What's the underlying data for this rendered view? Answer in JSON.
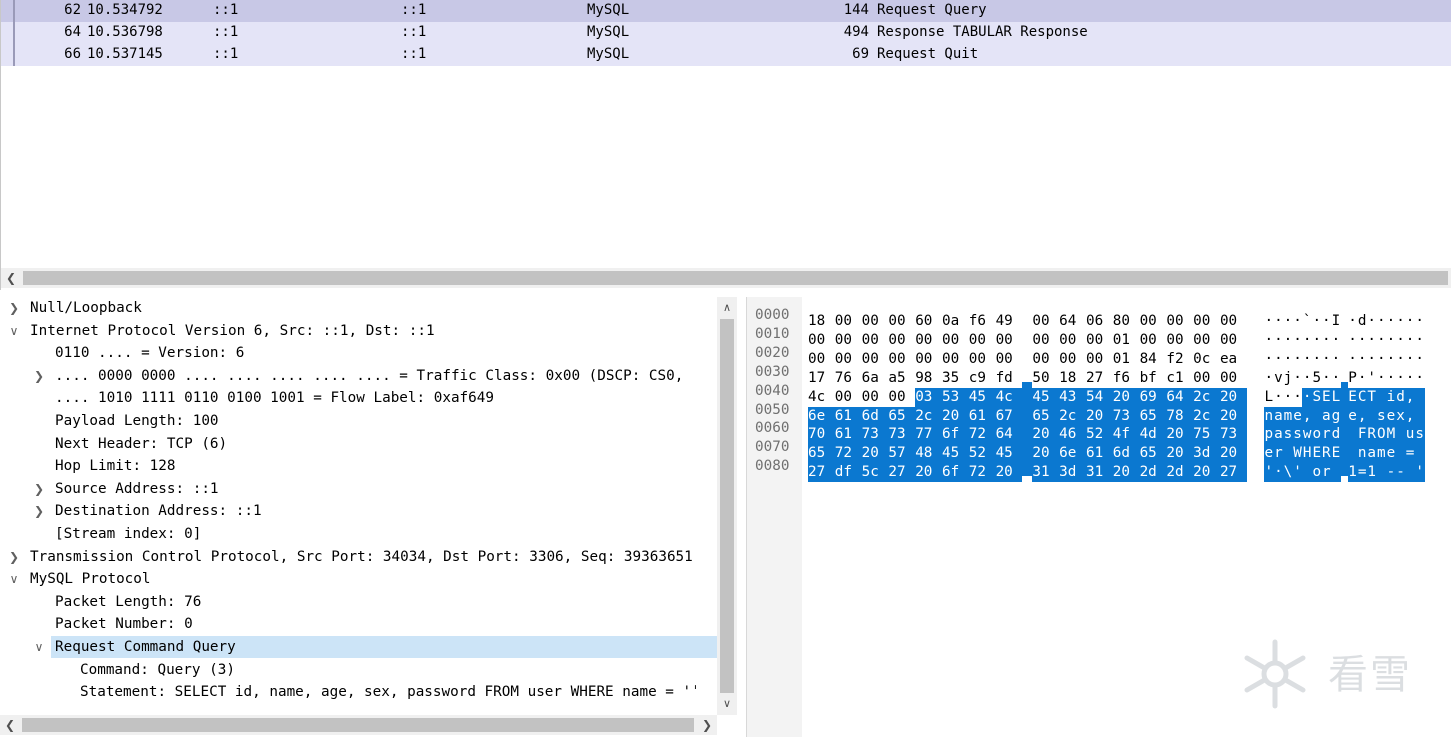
{
  "packet_list": {
    "rows": [
      {
        "no": "62",
        "time": "10.534792",
        "src": "::1",
        "dst": "::1",
        "proto": "MySQL",
        "len": "144",
        "info": "Request Query",
        "state": "selected"
      },
      {
        "no": "64",
        "time": "10.536798",
        "src": "::1",
        "dst": "::1",
        "proto": "MySQL",
        "len": "494",
        "info": "Response TABULAR Response",
        "state": "normal"
      },
      {
        "no": "66",
        "time": "10.537145",
        "src": "::1",
        "dst": "::1",
        "proto": "MySQL",
        "len": "69",
        "info": "Request Quit",
        "state": "normal"
      }
    ]
  },
  "details": {
    "rows": [
      {
        "indent": 0,
        "twisty": "collapsed",
        "text": "Null/Loopback"
      },
      {
        "indent": 0,
        "twisty": "expanded",
        "text": "Internet Protocol Version 6, Src: ::1, Dst: ::1"
      },
      {
        "indent": 1,
        "twisty": "none",
        "text": "0110 .... = Version: 6"
      },
      {
        "indent": 1,
        "twisty": "collapsed",
        "text": ".... 0000 0000 .... .... .... .... .... = Traffic Class: 0x00 (DSCP: CS0,"
      },
      {
        "indent": 1,
        "twisty": "none",
        "text": ".... 1010 1111 0110 0100 1001 = Flow Label: 0xaf649"
      },
      {
        "indent": 1,
        "twisty": "none",
        "text": "Payload Length: 100"
      },
      {
        "indent": 1,
        "twisty": "none",
        "text": "Next Header: TCP (6)"
      },
      {
        "indent": 1,
        "twisty": "none",
        "text": "Hop Limit: 128"
      },
      {
        "indent": 1,
        "twisty": "collapsed",
        "text": "Source Address: ::1"
      },
      {
        "indent": 1,
        "twisty": "collapsed",
        "text": "Destination Address: ::1"
      },
      {
        "indent": 1,
        "twisty": "none",
        "text": "[Stream index: 0]"
      },
      {
        "indent": 0,
        "twisty": "collapsed",
        "text": "Transmission Control Protocol, Src Port: 34034, Dst Port: 3306, Seq: 39363651"
      },
      {
        "indent": 0,
        "twisty": "expanded",
        "text": "MySQL Protocol"
      },
      {
        "indent": 1,
        "twisty": "none",
        "text": "Packet Length: 76"
      },
      {
        "indent": 1,
        "twisty": "none",
        "text": "Packet Number: 0"
      },
      {
        "indent": 1,
        "twisty": "expanded",
        "text": "Request Command Query",
        "highlight": true
      },
      {
        "indent": 2,
        "twisty": "none",
        "text": "Command: Query (3)"
      },
      {
        "indent": 2,
        "twisty": "none",
        "text": "Statement: SELECT id, name, age, sex, password FROM user WHERE name = 'ˈ"
      }
    ]
  },
  "bytes": {
    "rows": [
      {
        "offset": "0000",
        "hex": [
          "18",
          "00",
          "00",
          "00",
          "60",
          "0a",
          "f6",
          "49",
          "00",
          "64",
          "06",
          "80",
          "00",
          "00",
          "00",
          "00"
        ],
        "ascii": [
          "·",
          "·",
          "·",
          "·",
          "`",
          "·",
          "·",
          "I",
          "·",
          "d",
          "·",
          "·",
          "·",
          "·",
          "·",
          "·"
        ],
        "sel_from": 16
      },
      {
        "offset": "0010",
        "hex": [
          "00",
          "00",
          "00",
          "00",
          "00",
          "00",
          "00",
          "00",
          "00",
          "00",
          "00",
          "01",
          "00",
          "00",
          "00",
          "00"
        ],
        "ascii": [
          "·",
          "·",
          "·",
          "·",
          "·",
          "·",
          "·",
          "·",
          "·",
          "·",
          "·",
          "·",
          "·",
          "·",
          "·",
          "·"
        ],
        "sel_from": 16
      },
      {
        "offset": "0020",
        "hex": [
          "00",
          "00",
          "00",
          "00",
          "00",
          "00",
          "00",
          "00",
          "00",
          "00",
          "00",
          "01",
          "84",
          "f2",
          "0c",
          "ea"
        ],
        "ascii": [
          "·",
          "·",
          "·",
          "·",
          "·",
          "·",
          "·",
          "·",
          "·",
          "·",
          "·",
          "·",
          "·",
          "·",
          "·",
          "·"
        ],
        "sel_from": 16
      },
      {
        "offset": "0030",
        "hex": [
          "17",
          "76",
          "6a",
          "a5",
          "98",
          "35",
          "c9",
          "fd",
          "50",
          "18",
          "27",
          "f6",
          "bf",
          "c1",
          "00",
          "00"
        ],
        "ascii": [
          "·",
          "v",
          "j",
          "·",
          "·",
          "5",
          "·",
          "·",
          "P",
          "·",
          "'",
          "·",
          "·",
          "·",
          "·",
          "·"
        ],
        "sel_from": 16
      },
      {
        "offset": "0040",
        "hex": [
          "4c",
          "00",
          "00",
          "00",
          "03",
          "53",
          "45",
          "4c",
          "45",
          "43",
          "54",
          "20",
          "69",
          "64",
          "2c",
          "20"
        ],
        "ascii": [
          "L",
          "·",
          "·",
          "·",
          "·",
          "S",
          "E",
          "L",
          "E",
          "C",
          "T",
          " ",
          "i",
          "d",
          ",",
          " "
        ],
        "sel_from": 4
      },
      {
        "offset": "0050",
        "hex": [
          "6e",
          "61",
          "6d",
          "65",
          "2c",
          "20",
          "61",
          "67",
          "65",
          "2c",
          "20",
          "73",
          "65",
          "78",
          "2c",
          "20"
        ],
        "ascii": [
          "n",
          "a",
          "m",
          "e",
          ",",
          " ",
          "a",
          "g",
          "e",
          ",",
          " ",
          "s",
          "e",
          "x",
          ",",
          " "
        ],
        "sel_from": 0
      },
      {
        "offset": "0060",
        "hex": [
          "70",
          "61",
          "73",
          "73",
          "77",
          "6f",
          "72",
          "64",
          "20",
          "46",
          "52",
          "4f",
          "4d",
          "20",
          "75",
          "73"
        ],
        "ascii": [
          "p",
          "a",
          "s",
          "s",
          "w",
          "o",
          "r",
          "d",
          " ",
          "F",
          "R",
          "O",
          "M",
          " ",
          "u",
          "s"
        ],
        "sel_from": 0
      },
      {
        "offset": "0070",
        "hex": [
          "65",
          "72",
          "20",
          "57",
          "48",
          "45",
          "52",
          "45",
          "20",
          "6e",
          "61",
          "6d",
          "65",
          "20",
          "3d",
          "20"
        ],
        "ascii": [
          "e",
          "r",
          " ",
          "W",
          "H",
          "E",
          "R",
          "E",
          " ",
          "n",
          "a",
          "m",
          "e",
          " ",
          "=",
          " "
        ],
        "sel_from": 0
      },
      {
        "offset": "0080",
        "hex": [
          "27",
          "df",
          "5c",
          "27",
          "20",
          "6f",
          "72",
          "20",
          "31",
          "3d",
          "31",
          "20",
          "2d",
          "2d",
          "20",
          "27"
        ],
        "ascii": [
          "'",
          "·",
          "\\",
          "'",
          " ",
          "o",
          "r",
          " ",
          "1",
          "=",
          "1",
          " ",
          "-",
          "-",
          " ",
          "'"
        ],
        "sel_from": 0
      }
    ]
  },
  "watermark": {
    "text": "看雪",
    "icon": "snowflake-logo"
  },
  "icons": {
    "twisty_collapsed": "chevron-right-icon",
    "twisty_expanded": "chevron-down-icon"
  },
  "colors": {
    "selected_row": "#c8c8e6",
    "alt_row": "#e4e4f7",
    "highlight_tree": "#cce4f7",
    "byte_selection": "#0b78d0"
  }
}
